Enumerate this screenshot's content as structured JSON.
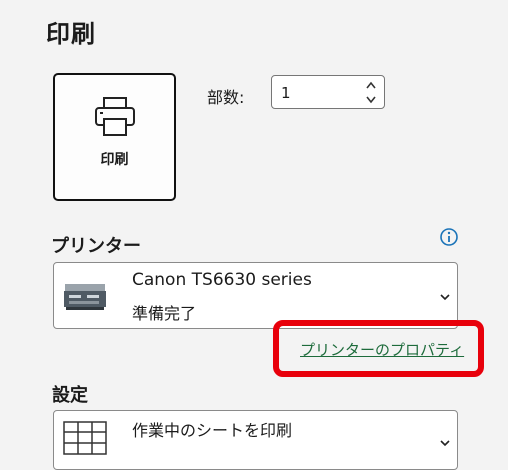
{
  "page": {
    "title": "印刷"
  },
  "print_button": {
    "label": "印刷",
    "icon": "printer-icon"
  },
  "copies": {
    "label": "部数:",
    "value": "1"
  },
  "printer": {
    "section_title": "プリンター",
    "info_icon": "info-icon",
    "selected_name": "Canon TS6630 series",
    "selected_status": "準備完了",
    "properties_link": "プリンターのプロパティ"
  },
  "settings": {
    "section_title": "設定",
    "selected": "作業中のシートを印刷"
  },
  "colors": {
    "highlight": "#e8000b",
    "link": "#1d6b3b",
    "info": "#1a73b8"
  }
}
